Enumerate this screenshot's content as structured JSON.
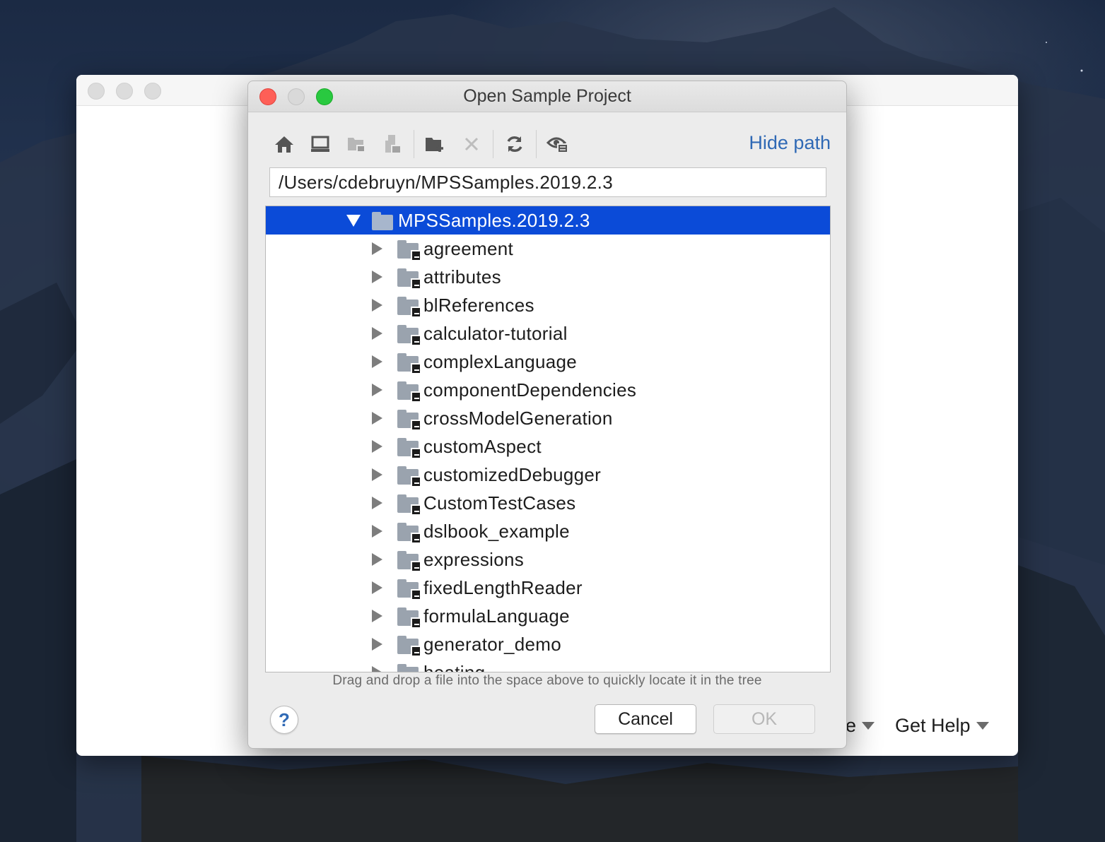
{
  "dialog": {
    "title": "Open Sample Project",
    "hide_path_label": "Hide path",
    "path_value": "/Users/cdebruyn/MPSSamples.2019.2.3",
    "hint": "Drag and drop a file into the space above to quickly locate it in the tree",
    "help_label": "?",
    "cancel_label": "Cancel",
    "ok_label": "OK"
  },
  "toolbar": {
    "icons": [
      "home-icon",
      "desktop-icon",
      "project-folder-icon",
      "module-icon",
      "new-folder-icon",
      "delete-icon",
      "refresh-icon",
      "show-hidden-icon"
    ]
  },
  "tree": {
    "root": "MPSSamples.2019.2.3",
    "items": [
      "agreement",
      "attributes",
      "blReferences",
      "calculator-tutorial",
      "complexLanguage",
      "componentDependencies",
      "crossModelGeneration",
      "customAspect",
      "customizedDebugger",
      "CustomTestCases",
      "dslbook_example",
      "expressions",
      "fixedLengthReader",
      "formulaLanguage",
      "generator_demo",
      "heating"
    ]
  },
  "back_window": {
    "menu_partial": "e",
    "get_help_label": "Get Help"
  },
  "colors": {
    "selection": "#0b4bd8",
    "link": "#2f69b5",
    "close_light": "#fe5f57",
    "zoom_light": "#29c940"
  }
}
